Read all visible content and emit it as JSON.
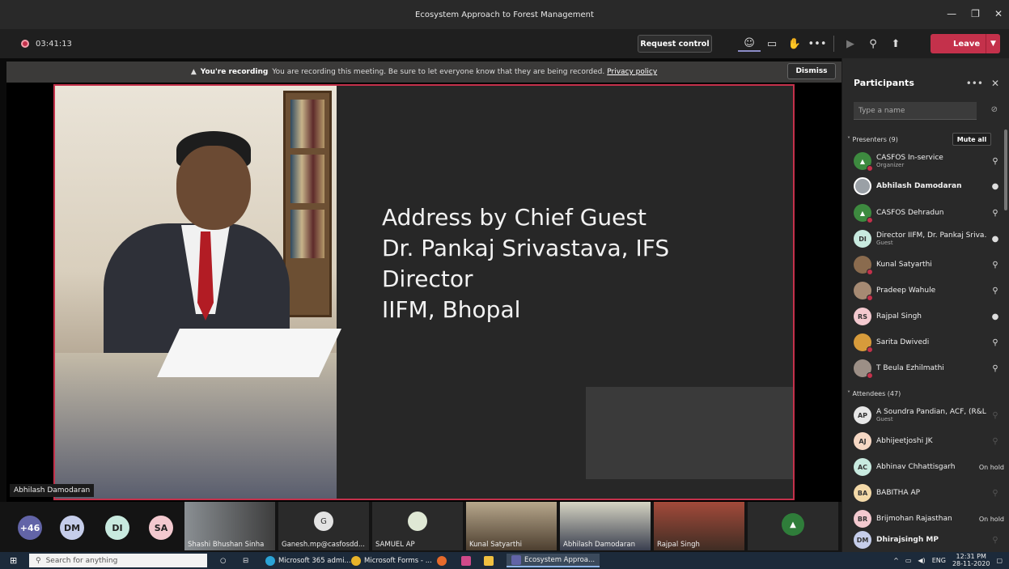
{
  "window": {
    "title": "Ecosystem Approach to Forest Management"
  },
  "meeting": {
    "timer": "03:41:13",
    "request_control": "Request control",
    "leave": "Leave"
  },
  "banner": {
    "title": "You're recording",
    "message": "You are recording this meeting. Be sure to let everyone know that they are being recorded.",
    "link": "Privacy policy",
    "dismiss": "Dismiss"
  },
  "slide": {
    "line1": "Address by Chief Guest",
    "line2": "Dr. Pankaj Srivastava, IFS",
    "line3": "Director",
    "line4": "IIFM, Bhopal"
  },
  "speaker": "Abhilash Damodaran",
  "strip": {
    "more": "+46",
    "avatars": [
      "DM",
      "DI",
      "SA"
    ],
    "tiles": [
      "Shashi Bhushan Sinha",
      "Ganesh.mp@casfosdd...",
      "SAMUEL AP",
      "Kunal Satyarthi",
      "Abhilash Damodaran",
      "Rajpal Singh"
    ],
    "ganesh_initial": "G"
  },
  "panel": {
    "title": "Participants",
    "search_placeholder": "Type a name",
    "presenters_label": "Presenters (9)",
    "mute_all": "Mute all",
    "attendees_label": "Attendees (47)",
    "presenters": [
      {
        "name": "CASFOS In-service",
        "sub": "Organizer",
        "initials": ""
      },
      {
        "name": "Abhilash Damodaran",
        "sub": "",
        "initials": ""
      },
      {
        "name": "CASFOS Dehradun",
        "sub": "",
        "initials": ""
      },
      {
        "name": "Director IIFM, Dr. Pankaj Sriva...",
        "sub": "Guest",
        "initials": "DI"
      },
      {
        "name": "Kunal Satyarthi",
        "sub": "",
        "initials": ""
      },
      {
        "name": "Pradeep Wahule",
        "sub": "",
        "initials": ""
      },
      {
        "name": "Rajpal Singh",
        "sub": "",
        "initials": "RS"
      },
      {
        "name": "Sarita Dwivedi",
        "sub": "",
        "initials": ""
      },
      {
        "name": "T Beula Ezhilmathi",
        "sub": "",
        "initials": ""
      }
    ],
    "attendees": [
      {
        "name": "A Soundra Pandian, ACF, (R&L...",
        "sub": "Guest",
        "initials": "AP",
        "status": ""
      },
      {
        "name": "Abhijeetjoshi JK",
        "sub": "",
        "initials": "AJ",
        "status": ""
      },
      {
        "name": "Abhinav Chhattisgarh",
        "sub": "",
        "initials": "AC",
        "status": "On hold"
      },
      {
        "name": "BABITHA AP",
        "sub": "",
        "initials": "BA",
        "status": ""
      },
      {
        "name": "Brijmohan Rajasthan",
        "sub": "",
        "initials": "BR",
        "status": "On hold"
      },
      {
        "name": "Dhirajsingh MP",
        "sub": "",
        "initials": "DM",
        "status": ""
      }
    ]
  },
  "taskbar": {
    "search": "Search for anything",
    "apps": [
      "Microsoft 365 admi...",
      "Microsoft Forms - ...",
      "Ecosystem Approa..."
    ],
    "lang": "ENG",
    "time": "12:31 PM",
    "date": "28-11-2020"
  }
}
